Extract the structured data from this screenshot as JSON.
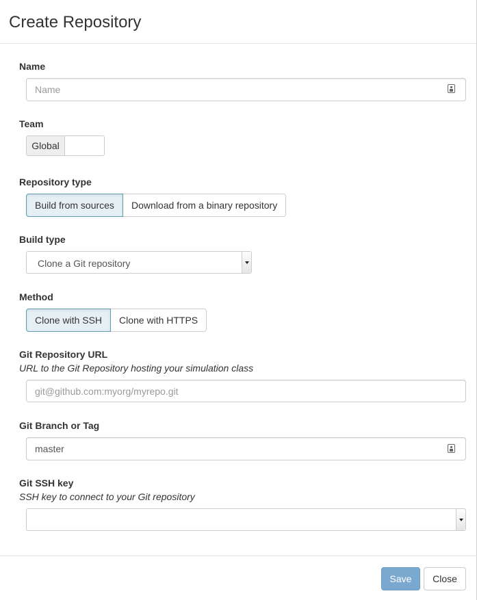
{
  "dialog": {
    "title": "Create Repository"
  },
  "name": {
    "label": "Name",
    "placeholder": "Name",
    "value": "",
    "icon": "contact-card-icon"
  },
  "team": {
    "label": "Team",
    "addon": "Global",
    "value": ""
  },
  "repository_type": {
    "label": "Repository type",
    "options": [
      "Build from sources",
      "Download from a binary repository"
    ],
    "selected": "Build from sources"
  },
  "build_type": {
    "label": "Build type",
    "selected": "Clone a Git repository"
  },
  "method": {
    "label": "Method",
    "options": [
      "Clone with SSH",
      "Clone with HTTPS"
    ],
    "selected": "Clone with SSH"
  },
  "git_url": {
    "label": "Git Repository URL",
    "help": "URL to the Git Repository hosting your simulation class",
    "placeholder": "git@github.com:myorg/myrepo.git",
    "value": ""
  },
  "git_branch": {
    "label": "Git Branch or Tag",
    "value": "master",
    "icon": "contact-card-icon"
  },
  "git_ssh_key": {
    "label": "Git SSH key",
    "help": "SSH key to connect to your Git repository",
    "selected": ""
  },
  "footer": {
    "save_label": "Save",
    "close_label": "Close"
  },
  "colors": {
    "save_button": "#7aa8cf",
    "active_toggle_border": "#5b9bb0",
    "active_toggle_bg": "#e6f0f4"
  }
}
